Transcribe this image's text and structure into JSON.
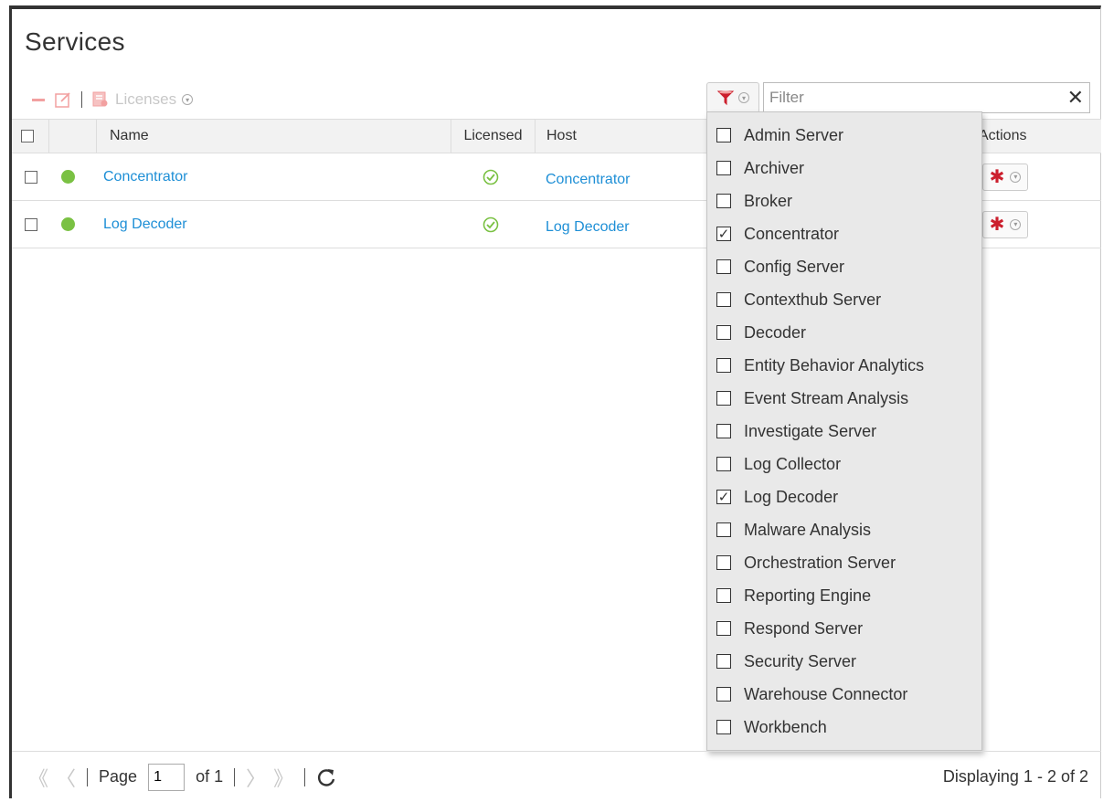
{
  "page": {
    "title": "Services"
  },
  "toolbar": {
    "licenses_label": "Licenses",
    "filter_placeholder": "Filter",
    "clear_icon": "✕"
  },
  "columns": {
    "name": "Name",
    "licensed": "Licensed",
    "host": "Host",
    "actions": "Actions"
  },
  "rows": [
    {
      "status_color": "#7ac143",
      "name": "Concentrator",
      "licensed_icon": "check-circle-icon",
      "host": "Concentrator"
    },
    {
      "status_color": "#7ac143",
      "name": "Log Decoder",
      "licensed_icon": "check-circle-icon",
      "host": "Log Decoder"
    }
  ],
  "filter_dropdown": {
    "items": [
      {
        "label": "Admin Server",
        "checked": false
      },
      {
        "label": "Archiver",
        "checked": false
      },
      {
        "label": "Broker",
        "checked": false
      },
      {
        "label": "Concentrator",
        "checked": true
      },
      {
        "label": "Config Server",
        "checked": false
      },
      {
        "label": "Contexthub Server",
        "checked": false
      },
      {
        "label": "Decoder",
        "checked": false
      },
      {
        "label": "Entity Behavior Analytics",
        "checked": false
      },
      {
        "label": "Event Stream Analysis",
        "checked": false
      },
      {
        "label": "Investigate Server",
        "checked": false
      },
      {
        "label": "Log Collector",
        "checked": false
      },
      {
        "label": "Log Decoder",
        "checked": true
      },
      {
        "label": "Malware Analysis",
        "checked": false
      },
      {
        "label": "Orchestration Server",
        "checked": false
      },
      {
        "label": "Reporting Engine",
        "checked": false
      },
      {
        "label": "Respond Server",
        "checked": false
      },
      {
        "label": "Security Server",
        "checked": false
      },
      {
        "label": "Warehouse Connector",
        "checked": false
      },
      {
        "label": "Workbench",
        "checked": false
      }
    ]
  },
  "pagination": {
    "page_label": "Page",
    "page_value": "1",
    "of_label": "of 1",
    "display_text": "Displaying 1 - 2 of 2"
  },
  "colors": {
    "accent_red": "#cc1f2d",
    "link_blue": "#1e8fd6",
    "status_green": "#7ac143"
  }
}
